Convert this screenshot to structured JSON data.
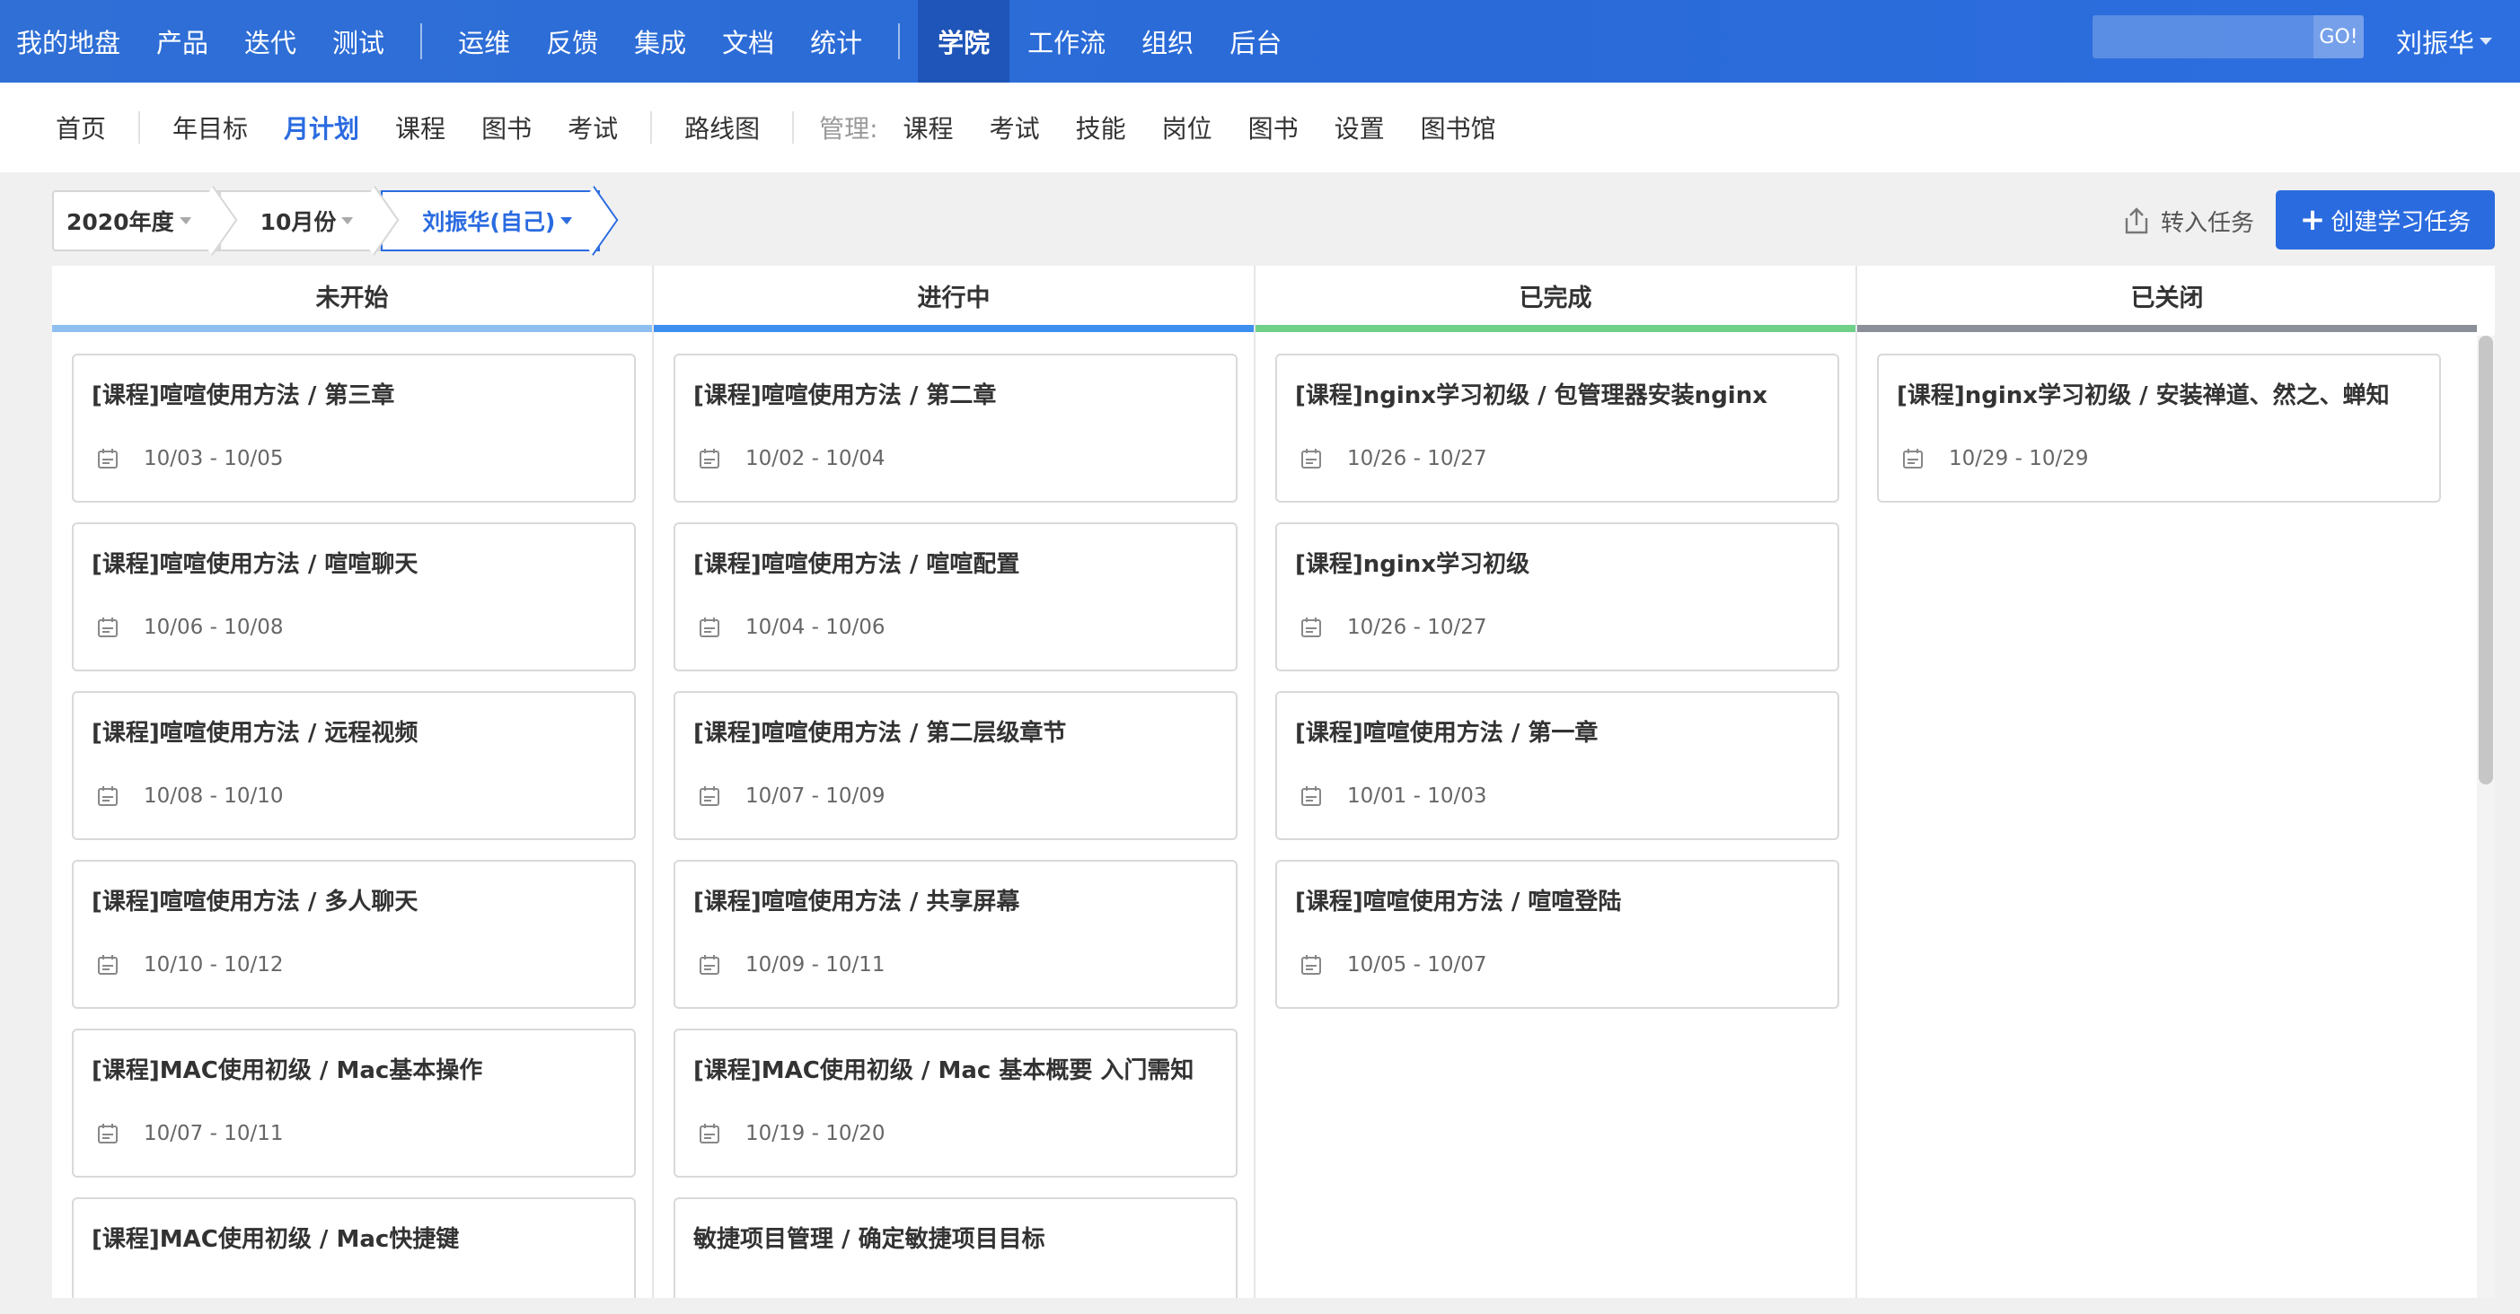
{
  "topnav": {
    "group1": [
      "我的地盘",
      "产品",
      "迭代",
      "测试"
    ],
    "group2": [
      "运维",
      "反馈",
      "集成",
      "文档",
      "统计"
    ],
    "group3": [
      "学院",
      "工作流",
      "组织",
      "后台"
    ],
    "active": "学院",
    "search_placeholder": "",
    "search_button": "GO!",
    "user": "刘振华"
  },
  "subnav": {
    "group1": [
      "首页"
    ],
    "group2": [
      "年目标",
      "月计划",
      "课程",
      "图书",
      "考试"
    ],
    "group3": [
      "路线图"
    ],
    "manage_label": "管理:",
    "manage_items": [
      "课程",
      "考试",
      "技能",
      "岗位",
      "图书",
      "设置",
      "图书馆"
    ],
    "active": "月计划"
  },
  "filters": {
    "year": "2020年度",
    "month": "10月份",
    "person": "刘振华(自己)"
  },
  "actions": {
    "import": "转入任务",
    "create": "创建学习任务"
  },
  "columns": [
    {
      "title": "未开始",
      "color": "#8fbff0",
      "cards": [
        {
          "title": "[课程]喧喧使用方法 / 第三章",
          "date": "10/03 - 10/05"
        },
        {
          "title": "[课程]喧喧使用方法 / 喧喧聊天",
          "date": "10/06 - 10/08"
        },
        {
          "title": "[课程]喧喧使用方法 / 远程视频",
          "date": "10/08 - 10/10"
        },
        {
          "title": "[课程]喧喧使用方法 / 多人聊天",
          "date": "10/10 - 10/12"
        },
        {
          "title": "[课程]MAC使用初级 / Mac基本操作",
          "date": "10/07 - 10/11"
        },
        {
          "title": "[课程]MAC使用初级 / Mac快捷键",
          "date": ""
        }
      ]
    },
    {
      "title": "进行中",
      "color": "#3d8ff0",
      "cards": [
        {
          "title": "[课程]喧喧使用方法 / 第二章",
          "date": "10/02 - 10/04"
        },
        {
          "title": "[课程]喧喧使用方法 / 喧喧配置",
          "date": "10/04 - 10/06"
        },
        {
          "title": "[课程]喧喧使用方法 / 第二层级章节",
          "date": "10/07 - 10/09"
        },
        {
          "title": "[课程]喧喧使用方法 / 共享屏幕",
          "date": "10/09 - 10/11"
        },
        {
          "title": "[课程]MAC使用初级 / Mac 基本概要 入门需知",
          "date": "10/19 - 10/20"
        },
        {
          "title": "敏捷项目管理 / 确定敏捷项目目标",
          "date": ""
        }
      ]
    },
    {
      "title": "已完成",
      "color": "#6fd08a",
      "cards": [
        {
          "title": "[课程]nginx学习初级 / 包管理器安装nginx",
          "date": "10/26 - 10/27"
        },
        {
          "title": "[课程]nginx学习初级",
          "date": "10/26 - 10/27"
        },
        {
          "title": "[课程]喧喧使用方法 / 第一章",
          "date": "10/01 - 10/03"
        },
        {
          "title": "[课程]喧喧使用方法 / 喧喧登陆",
          "date": "10/05 - 10/07"
        }
      ]
    },
    {
      "title": "已关闭",
      "color": "#8a8f99",
      "cards": [
        {
          "title": "[课程]nginx学习初级 / 安装禅道、然之、蝉知",
          "date": "10/29 - 10/29"
        }
      ]
    }
  ]
}
